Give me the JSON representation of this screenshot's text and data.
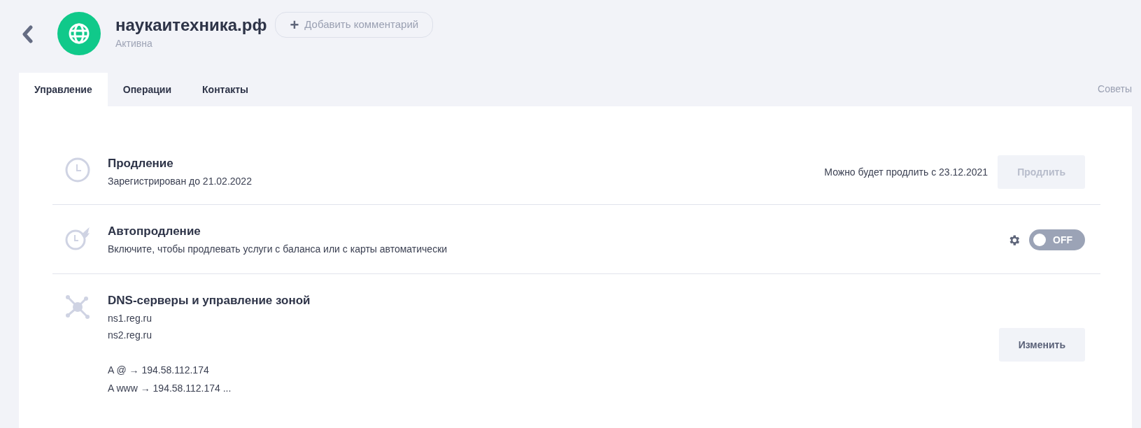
{
  "header": {
    "domain": "наукаитехника.рф",
    "status": "Активна",
    "comment_button": {
      "icon": "+",
      "label": "Добавить комментарий"
    }
  },
  "tabs": [
    {
      "label": "Управление",
      "selected": true
    },
    {
      "label": "Операции",
      "selected": false
    },
    {
      "label": "Контакты",
      "selected": false
    }
  ],
  "tips_link": "Советы",
  "sections": [
    {
      "kind": "button",
      "title": "Продление",
      "lines": [
        "Зарегистрирован до 21.02.2022"
      ],
      "note": "Можно будет продлить с 23.12.2021",
      "button": {
        "label": "Продлить",
        "disabled": true
      }
    },
    {
      "kind": "toggle",
      "title": "Автопродление",
      "lines": [
        "Включите, чтобы продлевать услуги с баланса или с карты автоматически"
      ],
      "toggle": {
        "on": false,
        "label": "OFF"
      }
    },
    {
      "kind": "button",
      "title": "DNS-серверы и управление зоной",
      "lines": [
        "ns1.reg.ru",
        "ns2.reg.ru"
      ],
      "records": [
        "A @ → 194.58.112.174",
        "A www → 194.58.112.174 ..."
      ],
      "button": {
        "label": "Изменить",
        "disabled": false
      }
    }
  ]
}
